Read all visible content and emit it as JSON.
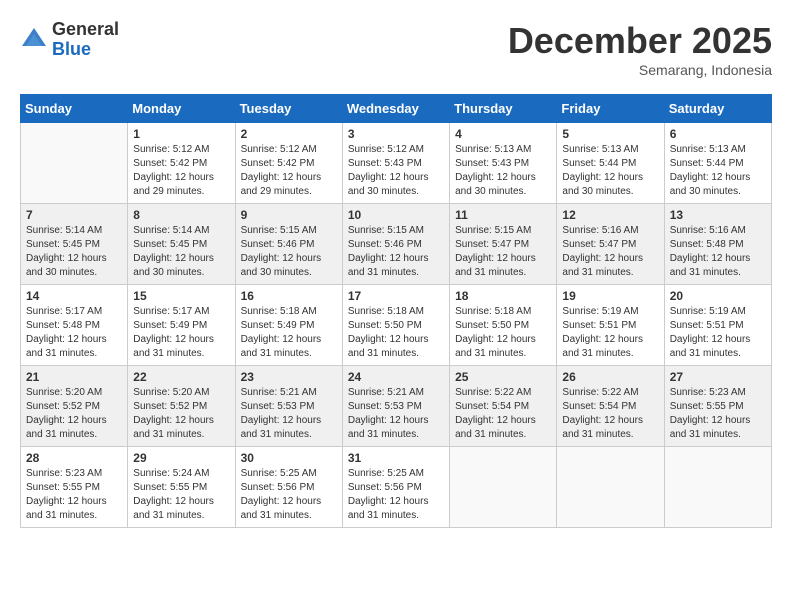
{
  "logo": {
    "general": "General",
    "blue": "Blue"
  },
  "header": {
    "month": "December 2025",
    "location": "Semarang, Indonesia"
  },
  "weekdays": [
    "Sunday",
    "Monday",
    "Tuesday",
    "Wednesday",
    "Thursday",
    "Friday",
    "Saturday"
  ],
  "weeks": [
    [
      {
        "day": "",
        "info": ""
      },
      {
        "day": "1",
        "info": "Sunrise: 5:12 AM\nSunset: 5:42 PM\nDaylight: 12 hours\nand 29 minutes."
      },
      {
        "day": "2",
        "info": "Sunrise: 5:12 AM\nSunset: 5:42 PM\nDaylight: 12 hours\nand 29 minutes."
      },
      {
        "day": "3",
        "info": "Sunrise: 5:12 AM\nSunset: 5:43 PM\nDaylight: 12 hours\nand 30 minutes."
      },
      {
        "day": "4",
        "info": "Sunrise: 5:13 AM\nSunset: 5:43 PM\nDaylight: 12 hours\nand 30 minutes."
      },
      {
        "day": "5",
        "info": "Sunrise: 5:13 AM\nSunset: 5:44 PM\nDaylight: 12 hours\nand 30 minutes."
      },
      {
        "day": "6",
        "info": "Sunrise: 5:13 AM\nSunset: 5:44 PM\nDaylight: 12 hours\nand 30 minutes."
      }
    ],
    [
      {
        "day": "7",
        "info": "Sunrise: 5:14 AM\nSunset: 5:45 PM\nDaylight: 12 hours\nand 30 minutes."
      },
      {
        "day": "8",
        "info": "Sunrise: 5:14 AM\nSunset: 5:45 PM\nDaylight: 12 hours\nand 30 minutes."
      },
      {
        "day": "9",
        "info": "Sunrise: 5:15 AM\nSunset: 5:46 PM\nDaylight: 12 hours\nand 30 minutes."
      },
      {
        "day": "10",
        "info": "Sunrise: 5:15 AM\nSunset: 5:46 PM\nDaylight: 12 hours\nand 31 minutes."
      },
      {
        "day": "11",
        "info": "Sunrise: 5:15 AM\nSunset: 5:47 PM\nDaylight: 12 hours\nand 31 minutes."
      },
      {
        "day": "12",
        "info": "Sunrise: 5:16 AM\nSunset: 5:47 PM\nDaylight: 12 hours\nand 31 minutes."
      },
      {
        "day": "13",
        "info": "Sunrise: 5:16 AM\nSunset: 5:48 PM\nDaylight: 12 hours\nand 31 minutes."
      }
    ],
    [
      {
        "day": "14",
        "info": "Sunrise: 5:17 AM\nSunset: 5:48 PM\nDaylight: 12 hours\nand 31 minutes."
      },
      {
        "day": "15",
        "info": "Sunrise: 5:17 AM\nSunset: 5:49 PM\nDaylight: 12 hours\nand 31 minutes."
      },
      {
        "day": "16",
        "info": "Sunrise: 5:18 AM\nSunset: 5:49 PM\nDaylight: 12 hours\nand 31 minutes."
      },
      {
        "day": "17",
        "info": "Sunrise: 5:18 AM\nSunset: 5:50 PM\nDaylight: 12 hours\nand 31 minutes."
      },
      {
        "day": "18",
        "info": "Sunrise: 5:18 AM\nSunset: 5:50 PM\nDaylight: 12 hours\nand 31 minutes."
      },
      {
        "day": "19",
        "info": "Sunrise: 5:19 AM\nSunset: 5:51 PM\nDaylight: 12 hours\nand 31 minutes."
      },
      {
        "day": "20",
        "info": "Sunrise: 5:19 AM\nSunset: 5:51 PM\nDaylight: 12 hours\nand 31 minutes."
      }
    ],
    [
      {
        "day": "21",
        "info": "Sunrise: 5:20 AM\nSunset: 5:52 PM\nDaylight: 12 hours\nand 31 minutes."
      },
      {
        "day": "22",
        "info": "Sunrise: 5:20 AM\nSunset: 5:52 PM\nDaylight: 12 hours\nand 31 minutes."
      },
      {
        "day": "23",
        "info": "Sunrise: 5:21 AM\nSunset: 5:53 PM\nDaylight: 12 hours\nand 31 minutes."
      },
      {
        "day": "24",
        "info": "Sunrise: 5:21 AM\nSunset: 5:53 PM\nDaylight: 12 hours\nand 31 minutes."
      },
      {
        "day": "25",
        "info": "Sunrise: 5:22 AM\nSunset: 5:54 PM\nDaylight: 12 hours\nand 31 minutes."
      },
      {
        "day": "26",
        "info": "Sunrise: 5:22 AM\nSunset: 5:54 PM\nDaylight: 12 hours\nand 31 minutes."
      },
      {
        "day": "27",
        "info": "Sunrise: 5:23 AM\nSunset: 5:55 PM\nDaylight: 12 hours\nand 31 minutes."
      }
    ],
    [
      {
        "day": "28",
        "info": "Sunrise: 5:23 AM\nSunset: 5:55 PM\nDaylight: 12 hours\nand 31 minutes."
      },
      {
        "day": "29",
        "info": "Sunrise: 5:24 AM\nSunset: 5:55 PM\nDaylight: 12 hours\nand 31 minutes."
      },
      {
        "day": "30",
        "info": "Sunrise: 5:25 AM\nSunset: 5:56 PM\nDaylight: 12 hours\nand 31 minutes."
      },
      {
        "day": "31",
        "info": "Sunrise: 5:25 AM\nSunset: 5:56 PM\nDaylight: 12 hours\nand 31 minutes."
      },
      {
        "day": "",
        "info": ""
      },
      {
        "day": "",
        "info": ""
      },
      {
        "day": "",
        "info": ""
      }
    ]
  ]
}
